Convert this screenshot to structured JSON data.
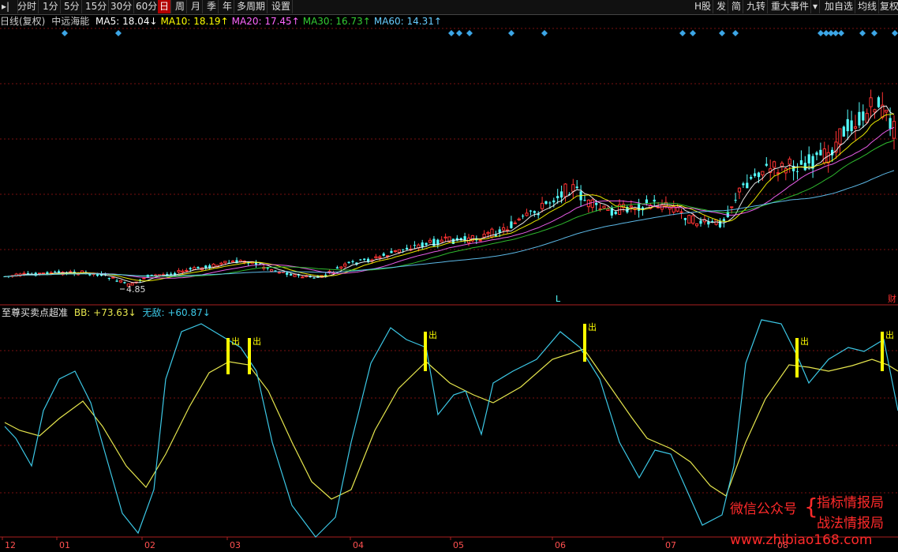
{
  "toolbar": {
    "left_items": [
      "分时",
      "1分",
      "5分",
      "15分",
      "30分",
      "60分",
      "日",
      "周",
      "月",
      "季",
      "年",
      "多周期",
      "设置"
    ],
    "active_index": 6,
    "right_items": [
      "H股",
      "发",
      "简",
      "九转",
      "重大事件",
      "加自选",
      "均线",
      "复权"
    ]
  },
  "header": {
    "period": "日线(复权)",
    "stock_name": "中远海能",
    "ma": [
      {
        "label": "MA5: 18.04↓",
        "color": "#ffffff"
      },
      {
        "label": "MA10: 18.19↑",
        "color": "#ffff00"
      },
      {
        "label": "MA20: 17.45↑",
        "color": "#ff66ff"
      },
      {
        "label": "MA30: 16.73↑",
        "color": "#33cc33"
      },
      {
        "label": "MA60: 14.31↑",
        "color": "#66ccff"
      }
    ]
  },
  "indicator": {
    "name": "至尊买卖点超准",
    "bb_label": "BB: +73.63↓",
    "wudi_label": "无敌: +60.87↓"
  },
  "annotations": {
    "low_price": "4.85",
    "l_marker": "L",
    "cai_marker": "财",
    "sell_signal": "出"
  },
  "colors": {
    "up": "#ff3232",
    "down": "#54ffff",
    "bb": "#e6e64d",
    "wudi": "#3cc8e6",
    "grid": "#7a1010",
    "signal": "#ffff00",
    "diamond": "#3ca6e6"
  },
  "chart_data": {
    "type": "candlestick",
    "x_ticks": [
      "12",
      "01",
      "02",
      "03",
      "04",
      "05",
      "06",
      "07",
      "08"
    ],
    "price": {
      "low_point": 4.85
    },
    "indicator_series": [
      {
        "name": "BB",
        "latest": 73.63
      },
      {
        "name": "无敌",
        "latest": 60.87
      }
    ],
    "sell_signal_count": 7,
    "diamond_count": 19
  },
  "watermark": {
    "line1": "微信公众号",
    "line2a": "指标情报局",
    "line2b": "战法情报局",
    "url": "www.zhibiao168.com"
  }
}
